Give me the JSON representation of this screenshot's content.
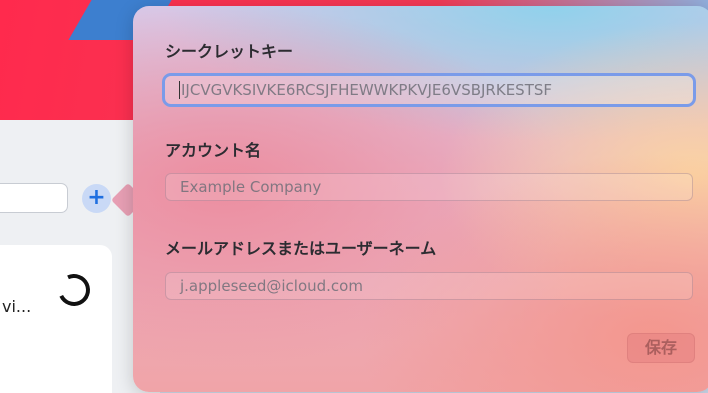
{
  "background": {
    "card_text": "vi..."
  },
  "form": {
    "secret_key": {
      "label": "シークレットキー",
      "placeholder": "IJCVGVKSIVKE6RCSJFHEWWKPKVJE6VSBJRKESTSF"
    },
    "account_name": {
      "label": "アカウント名",
      "placeholder": "Example Company"
    },
    "username": {
      "label": "メールアドレスまたはユーザーネーム",
      "placeholder": "j.appleseed@icloud.com"
    },
    "save_label": "保存"
  },
  "icons": {
    "add": "plus-icon",
    "loading": "spinner-icon"
  },
  "colors": {
    "accent": "#1f6fe0",
    "focus_ring": "#7a9be9"
  }
}
